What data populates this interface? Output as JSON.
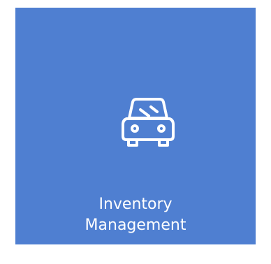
{
  "tile": {
    "label_line1": "Inventory",
    "label_line2": "Management",
    "icon": "car-icon",
    "background_color": "#4f7fd1",
    "foreground_color": "#ffffff"
  }
}
